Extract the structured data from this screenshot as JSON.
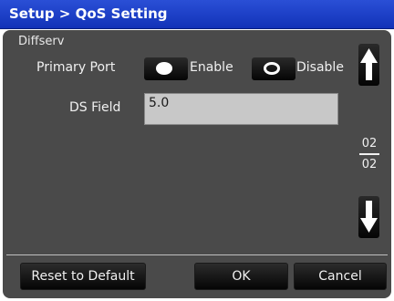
{
  "window": {
    "title": "Setup > QoS Setting"
  },
  "diffserv": {
    "group_label": "Diffserv",
    "primary_port": {
      "label": "Primary Port",
      "options": [
        {
          "label": "Enable",
          "selected": true
        },
        {
          "label": "Disable",
          "selected": false
        }
      ]
    },
    "ds_field": {
      "label": "DS Field",
      "value": "5.0"
    }
  },
  "pager": {
    "current": "02",
    "total": "02",
    "up_icon": "arrow-up-icon",
    "down_icon": "arrow-down-icon"
  },
  "buttons": {
    "reset_label": "Reset to Default",
    "ok_label": "OK",
    "cancel_label": "Cancel"
  },
  "colors": {
    "titlebar": "#1f3fcc",
    "panel": "#4a4a4a",
    "button": "#0a0a0a",
    "input": "#c8c8c8"
  }
}
